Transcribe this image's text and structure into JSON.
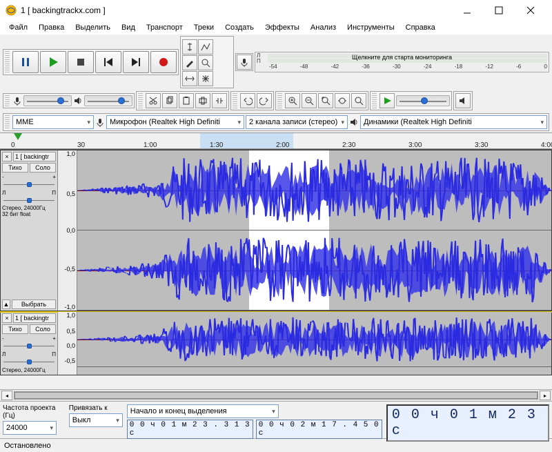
{
  "window": {
    "title": "1 [ backingtrackx.com ]"
  },
  "menu": [
    "Файл",
    "Правка",
    "Выделить",
    "Вид",
    "Транспорт",
    "Треки",
    "Создать",
    "Эффекты",
    "Анализ",
    "Инструменты",
    "Справка"
  ],
  "transport_icons": [
    "pause",
    "play",
    "stop",
    "skip-start",
    "skip-end",
    "record"
  ],
  "tool_icons_row1": [
    "ibeam",
    "envelope",
    "draw",
    "zoom",
    "timeshift",
    "multi"
  ],
  "tool_icons_row2": [
    "cut",
    "copy",
    "paste",
    "trim",
    "silence",
    "undo",
    "redo",
    "zoom-in",
    "zoom-out",
    "zoom-sel",
    "fit-width",
    "fit-height"
  ],
  "play_meter": {
    "labels": [
      "Л",
      "П"
    ],
    "clicktext": "Щелкните для старта мониторинга",
    "ticks": [
      "-54",
      "-48",
      "-42",
      "-36",
      "-30",
      "-24",
      "-18",
      "-12",
      "-6",
      "0"
    ]
  },
  "rec_meter": {
    "labels": [
      "Л",
      "П"
    ],
    "ticks": [
      "-54",
      "-48",
      "-42",
      "-36",
      "-30",
      "-24",
      "-18",
      "-12",
      "-6",
      "0"
    ]
  },
  "device": {
    "host_values": [
      "MME"
    ],
    "host_selected": "MME",
    "input_selected": "Микрофон (Realtek High Definiti",
    "channels_selected": "2 канала записи (стерео)",
    "output_selected": "Динамики (Realtek High Definiti"
  },
  "timeline": {
    "labels": [
      "0",
      "30",
      "1:00",
      "1:30",
      "2:00",
      "2:30",
      "3:00",
      "3:30",
      "4:00"
    ],
    "selection_start_frac": 0.3625,
    "selection_end_frac": 0.5313
  },
  "tracks": [
    {
      "name": "1 [ backingtr",
      "mute": "Тихо",
      "solo": "Соло",
      "gain_labels": [
        "-",
        "+"
      ],
      "pan_labels": [
        "Л",
        "П"
      ],
      "info": "Стерео, 24000Гц\n32 бит float",
      "select_btn": "Выбрать",
      "channels": 2,
      "selected": true
    },
    {
      "name": "1 [ backingtr",
      "mute": "Тихо",
      "solo": "Соло",
      "gain_labels": [
        "-",
        "+"
      ],
      "pan_labels": [
        "Л",
        "П"
      ],
      "info": "Стерео, 24000Гц",
      "channels": 1,
      "selected": false
    }
  ],
  "scale_labels": [
    "1,0",
    "0,5",
    "0,0",
    "-0,5",
    "-1,0"
  ],
  "bottom": {
    "project_rate_label": "Частота проекта (Гц)",
    "project_rate": "24000",
    "snap_label": "Привязать к",
    "snap_value": "Выкл",
    "selection_mode": "Начало и конец выделения",
    "sel_start": "0 0 ч 0 1 м 2 3 . 3 1 3 с",
    "sel_end": "0 0 ч 0 2 м 1 7 . 4 5 0 с",
    "bigtime": "0 0 ч 0 1 м 2 3 с"
  },
  "status": "Остановлено"
}
